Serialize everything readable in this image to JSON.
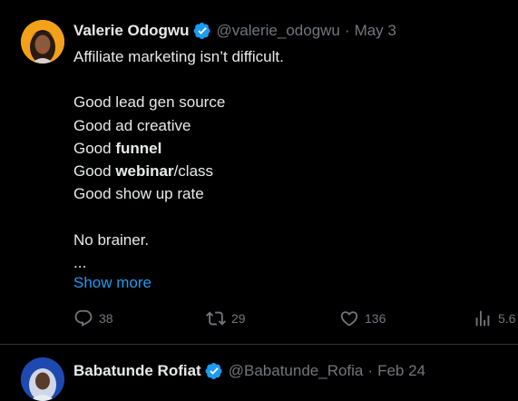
{
  "tweets": [
    {
      "author_name": "Valerie Odogwu",
      "handle": "@valerie_odogwu",
      "separator": "·",
      "date": "May 3",
      "lines": [
        {
          "text": "Affiliate marketing isn’t difficult."
        },
        {
          "text": ""
        },
        {
          "text": "Good lead gen source"
        },
        {
          "text": "Good ad creative"
        },
        {
          "pre": "Good ",
          "bold": "funnel",
          "post": ""
        },
        {
          "pre": "Good ",
          "bold": "webinar",
          "post": "/class"
        },
        {
          "text": "Good show up rate"
        },
        {
          "text": ""
        },
        {
          "text": "No brainer."
        },
        {
          "text": "..."
        }
      ],
      "show_more": "Show more",
      "replies": "38",
      "reposts": "29",
      "likes": "136",
      "views": "5.6"
    },
    {
      "author_name": "Babatunde Rofiat",
      "handle": "@Babatunde_Rofia",
      "separator": "·",
      "date": "Feb 24"
    }
  ],
  "icons": {
    "verified": "verified-badge-icon",
    "reply": "reply-icon",
    "repost": "repost-icon",
    "like": "heart-icon",
    "views": "views-icon"
  },
  "colors": {
    "background": "#000000",
    "text": "#e7e9ea",
    "muted": "#71767b",
    "link": "#1d9bf0",
    "divider": "#2f3336"
  }
}
